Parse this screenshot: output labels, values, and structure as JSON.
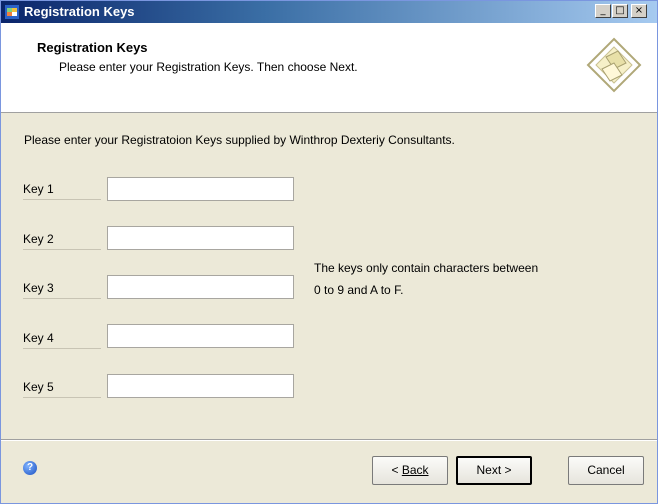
{
  "window": {
    "title": "Registration Keys"
  },
  "titlebar": {
    "minimize": "_",
    "maximize": "□",
    "close": "×"
  },
  "header": {
    "title": "Registration Keys",
    "subtitle": "Please enter your Registration Keys. Then choose Next."
  },
  "main": {
    "intro": "Please enter your Registratoion Keys supplied by Winthrop Dexteriy Consultants.",
    "keys": [
      {
        "label": "Key 1",
        "value": ""
      },
      {
        "label": "Key 2",
        "value": ""
      },
      {
        "label": "Key 3",
        "value": ""
      },
      {
        "label": "Key 4",
        "value": ""
      },
      {
        "label": "Key 5",
        "value": ""
      }
    ],
    "note_line1": "The keys only contain characters between",
    "note_line2": "0 to 9 and A to F."
  },
  "footer": {
    "help_icon": "question-circle-icon",
    "back_label": "Back",
    "back_prefix": "< ",
    "next_label": "Next >",
    "cancel_label": "Cancel"
  }
}
